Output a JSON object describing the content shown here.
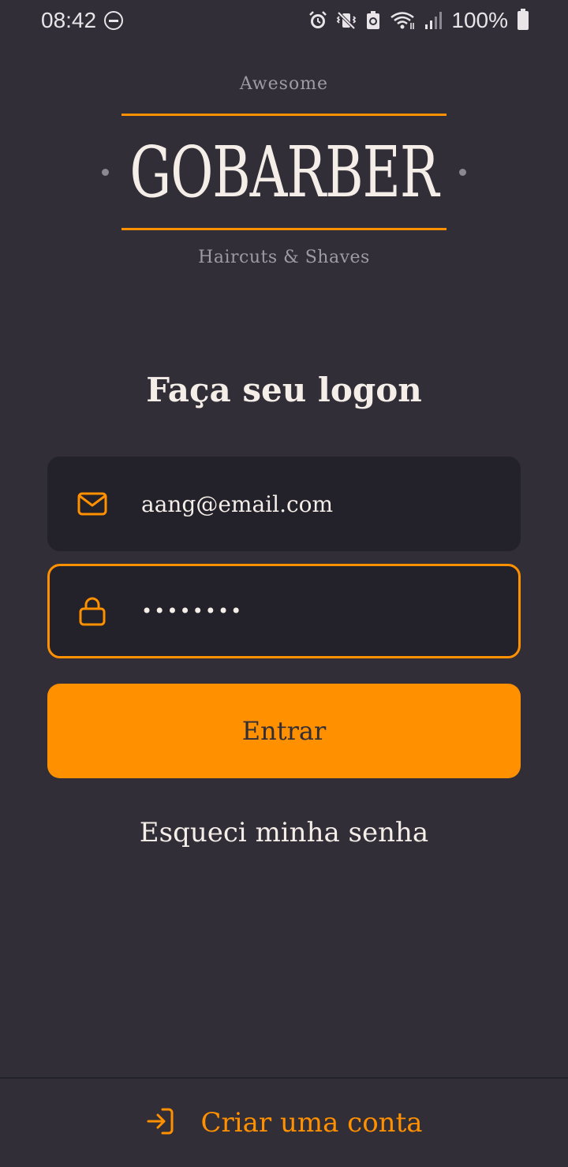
{
  "status_bar": {
    "time": "08:42",
    "battery": "100%",
    "icons": [
      "do-not-disturb-icon",
      "alarm-icon",
      "vibrate-icon",
      "battery-saver-icon",
      "wifi-icon",
      "signal-icon",
      "battery-icon"
    ]
  },
  "logo": {
    "top_text": "Awesome",
    "brand": "GOBARBER",
    "bottom_text": "Haircuts & Shaves"
  },
  "login": {
    "title": "Faça seu logon",
    "email_value": "aang@email.com",
    "email_icon": "mail-icon",
    "password_value": "••••••••",
    "password_icon": "lock-icon",
    "submit_label": "Entrar",
    "forgot_label": "Esqueci minha senha"
  },
  "footer": {
    "create_account_label": "Criar uma conta",
    "icon": "log-in-icon"
  },
  "colors": {
    "background": "#312e38",
    "input_background": "#232129",
    "accent": "#ff9000",
    "text": "#f4ede8",
    "muted": "#a09aa2"
  }
}
